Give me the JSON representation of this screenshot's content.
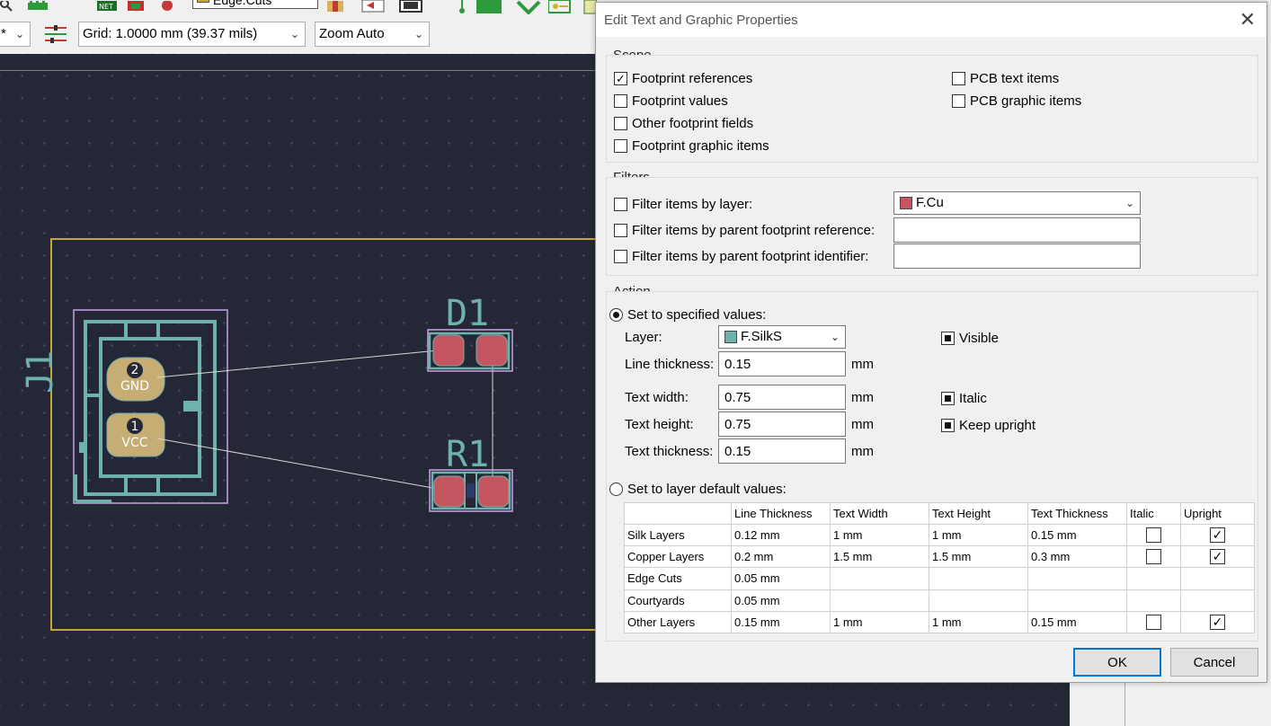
{
  "toolbar": {
    "layer_selector": "Edge.Cuts",
    "unit_selector": "*",
    "grid_selector": "Grid: 1.0000 mm (39.37 mils)",
    "zoom_selector": "Zoom Auto",
    "net_icon_label": "NET"
  },
  "board": {
    "footprints": [
      {
        "reference": "J1",
        "pads": [
          {
            "number": "2",
            "net": "GND"
          },
          {
            "number": "1",
            "net": "VCC"
          }
        ]
      },
      {
        "reference": "D1"
      },
      {
        "reference": "R1"
      }
    ],
    "colors": {
      "background": "#242836",
      "silk": "#6fb1ad",
      "pad_tht": "#c6ad74",
      "pad_smd": "#c5565f",
      "edge": "#c9a533",
      "courtyard": "#c9a0e8"
    }
  },
  "dialog": {
    "title": "Edit Text and Graphic Properties",
    "scope": {
      "label": "Scope",
      "items": [
        {
          "label": "Footprint references",
          "checked": true
        },
        {
          "label": "Footprint values",
          "checked": false
        },
        {
          "label": "Other footprint fields",
          "checked": false
        },
        {
          "label": "Footprint graphic items",
          "checked": false
        },
        {
          "label": "PCB text items",
          "checked": false
        },
        {
          "label": "PCB graphic items",
          "checked": false
        }
      ]
    },
    "filters": {
      "label": "Filters",
      "by_layer": {
        "label": "Filter items by layer:",
        "value": "F.Cu",
        "color": "#c5565f"
      },
      "by_ref": {
        "label": "Filter items by parent footprint reference:",
        "value": ""
      },
      "by_id": {
        "label": "Filter items by parent footprint identifier:",
        "value": ""
      }
    },
    "action": {
      "label": "Action",
      "set_specified": "Set to specified values:",
      "layer_label": "Layer:",
      "layer_value": "F.SilkS",
      "layer_color": "#6fb1ad",
      "line_thickness_label": "Line thickness:",
      "line_thickness": "0.15",
      "text_width_label": "Text width:",
      "text_width": "0.75",
      "text_height_label": "Text height:",
      "text_height": "0.75",
      "text_thickness_label": "Text thickness:",
      "text_thickness": "0.15",
      "unit": "mm",
      "visible_label": "Visible",
      "italic_label": "Italic",
      "keep_upright_label": "Keep upright",
      "set_default": "Set to layer default values:"
    },
    "defaults_table": {
      "columns": [
        "",
        "Line Thickness",
        "Text Width",
        "Text Height",
        "Text Thickness",
        "Italic",
        "Upright"
      ],
      "rows": [
        {
          "name": "Silk Layers",
          "line": "0.12 mm",
          "width": "1 mm",
          "height": "1 mm",
          "thickness": "0.15 mm",
          "italic": false,
          "upright": true,
          "has_text": true
        },
        {
          "name": "Copper Layers",
          "line": "0.2 mm",
          "width": "1.5 mm",
          "height": "1.5 mm",
          "thickness": "0.3 mm",
          "italic": false,
          "upright": true,
          "has_text": true
        },
        {
          "name": "Edge Cuts",
          "line": "0.05 mm",
          "width": "",
          "height": "",
          "thickness": "",
          "has_text": false
        },
        {
          "name": "Courtyards",
          "line": "0.05 mm",
          "width": "",
          "height": "",
          "thickness": "",
          "has_text": false
        },
        {
          "name": "Other Layers",
          "line": "0.15 mm",
          "width": "1 mm",
          "height": "1 mm",
          "thickness": "0.15 mm",
          "italic": false,
          "upright": true,
          "has_text": true
        }
      ]
    },
    "buttons": {
      "ok": "OK",
      "cancel": "Cancel"
    }
  }
}
